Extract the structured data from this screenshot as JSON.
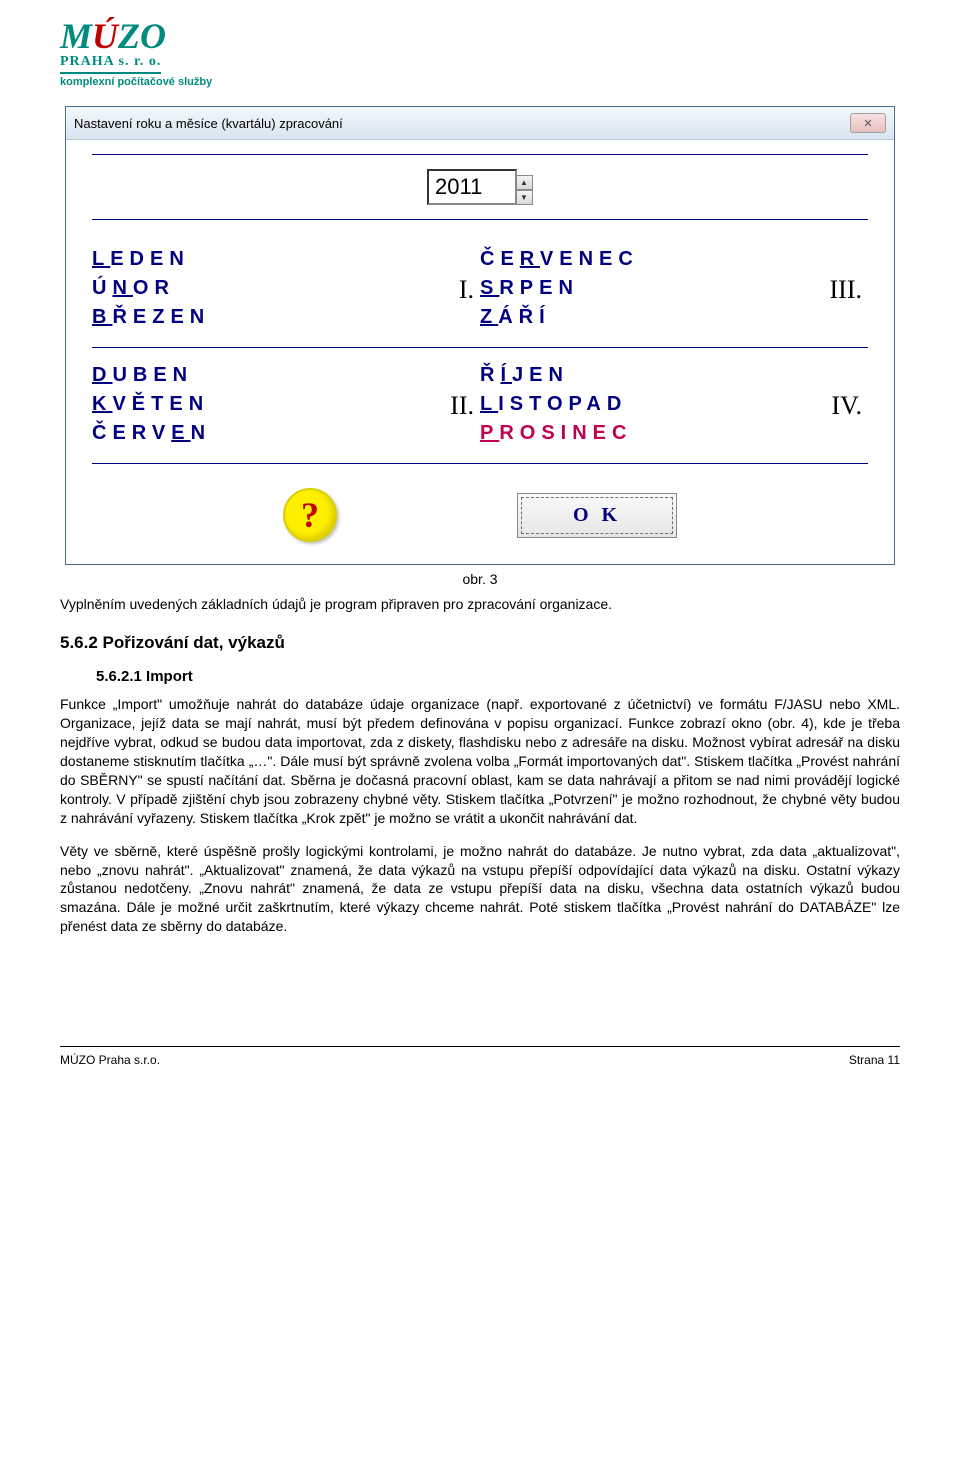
{
  "logo": {
    "main_pre": "M",
    "main_accent": "Ú",
    "main_post": "ZO",
    "sub1": "PRAHA s. r. o.",
    "sub2": "komplexní počítačové služby"
  },
  "window": {
    "title": "Nastavení roku a měsíce (kvartálu) zpracování",
    "close_glyph": "✕",
    "year_value": "2011",
    "spin_up": "▲",
    "spin_down": "▼",
    "quarters": {
      "q1": {
        "label": "I.",
        "months": [
          "LEDEN",
          "ÚNOR",
          "BŘEZEN"
        ],
        "underline_idx": [
          0,
          1,
          0
        ]
      },
      "q2": {
        "label": "II.",
        "months": [
          "DUBEN",
          "KVĚTEN",
          "ČERVEN"
        ],
        "underline_idx": [
          0,
          0,
          4
        ]
      },
      "q3": {
        "label": "III.",
        "months": [
          "ČERVENEC",
          "SRPEN",
          "ZÁŘÍ"
        ],
        "underline_idx": [
          2,
          0,
          0
        ]
      },
      "q4": {
        "label": "IV.",
        "months": [
          "ŘÍJEN",
          "LISTOPAD",
          "PROSINEC"
        ],
        "underline_idx": [
          1,
          0,
          0
        ],
        "current_month": "PROSINEC"
      }
    },
    "help_glyph": "?",
    "ok_label": "O K"
  },
  "caption": "obr. 3",
  "intro_line": "Vyplněním uvedených základních údajů je program připraven pro zpracování organizace.",
  "section_heading": "5.6.2  Pořizování dat, výkazů",
  "subsection_heading": "5.6.2.1  Import",
  "para1": "Funkce „Import\" umožňuje nahrát do databáze údaje organizace (např. exportované z účetnictví) ve formátu F/JASU nebo XML. Organizace, jejíž data se mají nahrát, musí být předem definována v popisu organizací. Funkce zobrazí okno (obr. 4), kde je třeba nejdříve vybrat, odkud se budou data importovat, zda z diskety, flashdisku nebo z adresáře na disku. Možnost vybírat adresář na disku dostaneme stisknutím tlačítka „…\". Dále musí být správně zvolena volba „Formát importovaných dat\". Stiskem tlačítka „Provést nahrání do SBĚRNY\" se spustí načítání dat. Sběrna je dočasná pracovní oblast, kam se data nahrávají a přitom se nad nimi provádějí logické kontroly. V případě zjištění chyb jsou zobrazeny chybné věty. Stiskem tlačítka „Potvrzení\" je možno rozhodnout, že chybné věty budou z nahrávání vyřazeny. Stiskem tlačítka „Krok zpět\" je možno se vrátit a ukončit nahrávání dat.",
  "para2": "Věty ve sběrně, které úspěšně prošly logickými kontrolami, je možno nahrát do databáze. Je nutno vybrat, zda data „aktualizovat\", nebo „znovu  nahrát\". „Aktualizovat\" znamená, že data výkazů na vstupu přepíší odpovídající data výkazů na disku. Ostatní výkazy zůstanou nedotčeny. „Znovu nahrát\" znamená, že data ze vstupu přepíší data na disku, všechna data ostatních výkazů budou smazána. Dále je možné určit zaškrtnutím, které výkazy chceme nahrát. Poté stiskem tlačítka „Provést nahrání do DATABÁZE\" lze přenést data ze sběrny do databáze.",
  "footer_left": "MÚZO Praha s.r.o.",
  "footer_right": "Strana 11"
}
